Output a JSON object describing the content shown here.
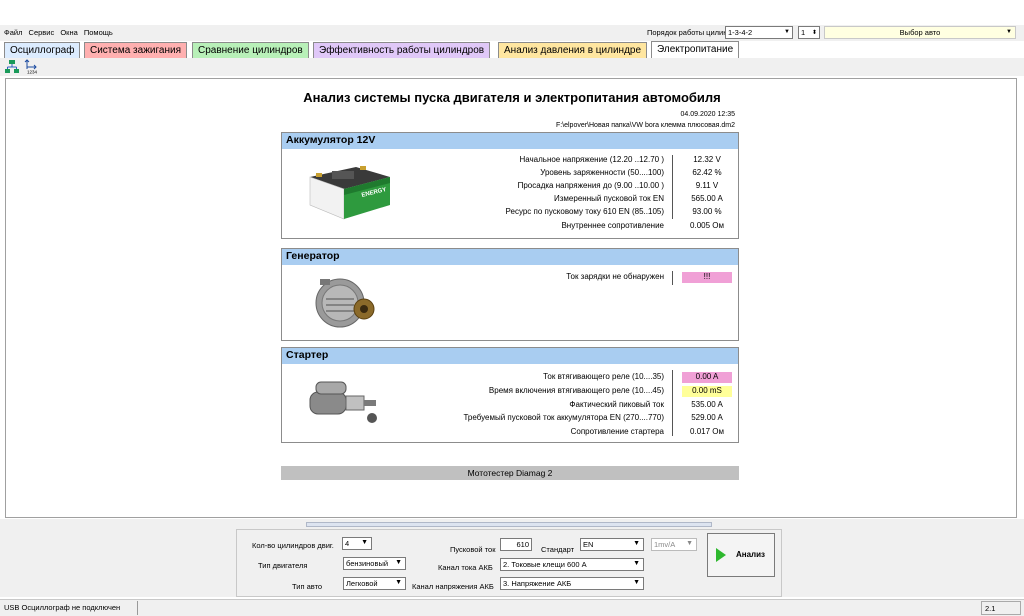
{
  "menu": [
    "Файл",
    "Сервис",
    "Окна",
    "Помощь"
  ],
  "cylinder_order": {
    "label": "Порядок работы цилиндров",
    "value": "1-3-4-2",
    "spin_value": "1"
  },
  "auto_select": "Выбор авто",
  "tabs": [
    {
      "label": "Осциллограф",
      "color": "#dcecff"
    },
    {
      "label": "Система зажигания",
      "color": "#ffb0b0"
    },
    {
      "label": "Сравнение цилиндров",
      "color": "#b8f0b8"
    },
    {
      "label": "Эффективность работы цилиндров",
      "color": "#e0c8f8"
    },
    {
      "label": "Анализ давления в цилиндре",
      "color": "#ffe6a0"
    },
    {
      "label": "Электропитание",
      "color": "#ffffff"
    }
  ],
  "report": {
    "title": "Анализ системы пуска двигателя и электропитания автомобиля",
    "date": "04.09.2020 12:35",
    "path": "F:\\elpover\\Новая папка\\VW bora клемма плюсовая.dm2"
  },
  "battery": {
    "title": "Аккумулятор 12V",
    "brand": "ENERGY",
    "rows": [
      {
        "label": "Начальное напряжение (12.20 ..12.70 )",
        "value": "12.32 V",
        "hl": ""
      },
      {
        "label": "Уровень заряженности (50....100)",
        "value": "62.42 %",
        "hl": ""
      },
      {
        "label": "Просадка напряжения до (9.00 ..10.00 )",
        "value": "9.11 V",
        "hl": ""
      },
      {
        "label": "Измеренный пусковой ток  EN",
        "value": "565.00 A",
        "hl": ""
      },
      {
        "label": "Ресурс по пусковому току  610 EN (85..105)",
        "value": "93.00 %",
        "hl": ""
      },
      {
        "label": "Внутреннее сопротивление",
        "value": "0.005 Ом",
        "hl": ""
      }
    ]
  },
  "generator": {
    "title": "Генератор",
    "rows": [
      {
        "label": "Ток зарядки не обнаружен",
        "value": "!!!",
        "hl": "pink"
      }
    ]
  },
  "starter": {
    "title": "Стартер",
    "rows": [
      {
        "label": "Ток втягивающего реле (10....35)",
        "value": "0.00 A",
        "hl": "pink"
      },
      {
        "label": "Время включения втягивающего реле (10....45)",
        "value": "0.00 mS",
        "hl": "yellow"
      },
      {
        "label": "Фактический пиковый ток",
        "value": "535.00 A",
        "hl": ""
      },
      {
        "label": "Требуемый пусковой ток аккумулятора  EN (270....770)",
        "value": "529.00 A",
        "hl": ""
      },
      {
        "label": "Сопротивление стартера",
        "value": "0.017 Ом",
        "hl": ""
      }
    ]
  },
  "footer": "Мототестер Diamag 2",
  "controls": {
    "cylinders_label": "Кол-во цилиндров двиг.",
    "cylinders_value": "4",
    "engine_label": "Тип двигателя",
    "engine_value": "бензиновый",
    "auto_type_label": "Тип авто",
    "auto_type_value": "Легковой",
    "start_current_label": "Пусковой ток",
    "start_current_value": "610",
    "standard_label": "Стандарт",
    "standard_value": "EN",
    "current_channel_label": "Канал тока АКБ",
    "current_channel_value": "2. Токовые клещи 600 А",
    "voltage_channel_label": "Канал напряжения АКБ",
    "voltage_channel_value": "3. Напряжение АКБ",
    "scale_value": "1mv/A",
    "analyze_label": "Анализ"
  },
  "status": {
    "left": "USB Осциллограф не подключен",
    "right": "2.1"
  }
}
